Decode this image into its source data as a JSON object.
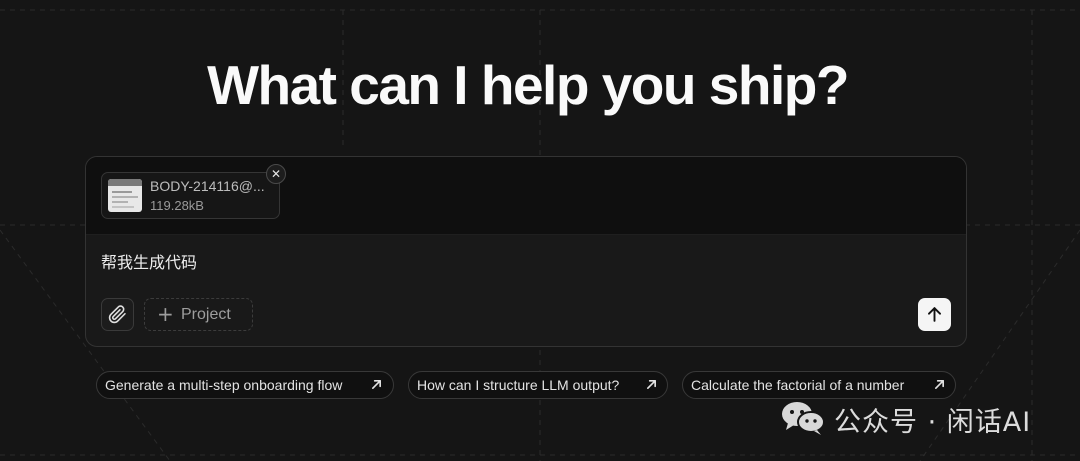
{
  "hero": {
    "title": "What can I help you ship?"
  },
  "composer": {
    "attachment": {
      "file_name": "BODY-214116@...",
      "file_size": "119.28kB",
      "remove_icon": "close-icon"
    },
    "prompt_text": "帮我生成代码",
    "attach_icon": "paperclip-icon",
    "project_button_label": "Project",
    "project_icon": "plus-icon",
    "send_icon": "arrow-up-icon"
  },
  "suggestions": [
    {
      "label": "Generate a multi-step onboarding flow",
      "icon": "arrow-up-right-icon"
    },
    {
      "label": "How can I structure LLM output?",
      "icon": "arrow-up-right-icon"
    },
    {
      "label": "Calculate the factorial of a number",
      "icon": "arrow-up-right-icon"
    }
  ],
  "watermark": {
    "text": "公众号 · 闲话AI",
    "icon": "wechat-icon"
  },
  "colors": {
    "background": "#151515",
    "card": "#191919",
    "border": "#333333",
    "send_button": "#f5f5f5"
  }
}
